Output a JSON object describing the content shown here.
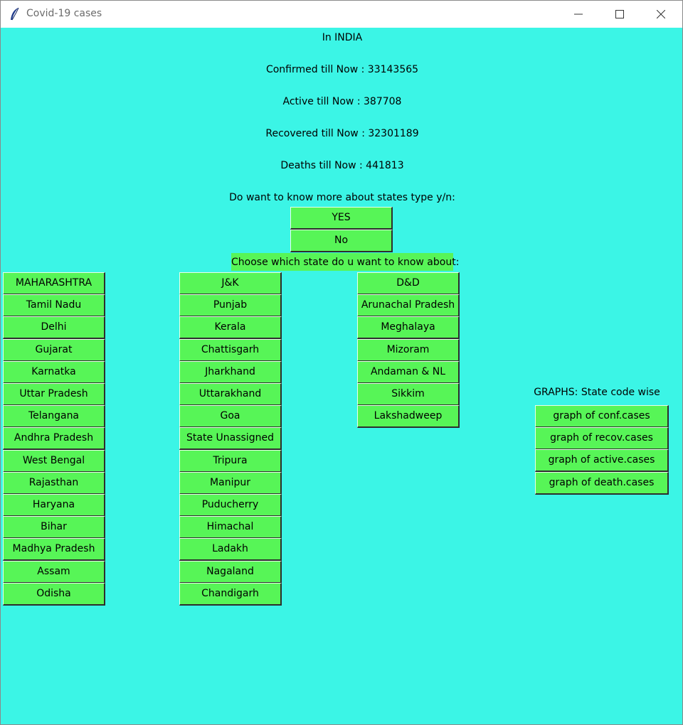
{
  "window": {
    "title": "Covid-19 cases"
  },
  "summary": {
    "country": "In INDIA",
    "confirmed": "Confirmed till Now : 33143565",
    "active": "Active till Now : 387708",
    "recovered": "Recovered till Now : 32301189",
    "deaths": "Deaths till Now : 441813"
  },
  "prompt": {
    "question": "Do want to know more about states type y/n:",
    "yes_label": "YES",
    "no_label": "No",
    "choose_label": "Choose which state do u want to know about:"
  },
  "states": {
    "column1": [
      "MAHARASHTRA",
      "Tamil Nadu",
      "Delhi",
      "Gujarat",
      "Karnatka",
      "Uttar Pradesh",
      "Telangana",
      "Andhra Pradesh",
      "West Bengal",
      "Rajasthan",
      "Haryana",
      "Bihar",
      "Madhya Pradesh",
      "Assam",
      "Odisha"
    ],
    "column2": [
      "J&K",
      "Punjab",
      "Kerala",
      "Chattisgarh",
      "Jharkhand",
      "Uttarakhand",
      "Goa",
      "State Unassigned",
      "Tripura",
      "Manipur",
      "Puducherry",
      "Himachal",
      "Ladakh",
      "Nagaland",
      "Chandigarh"
    ],
    "column3": [
      "D&D",
      "Arunachal Pradesh",
      "Meghalaya",
      "Mizoram",
      "Andaman & NL",
      "Sikkim",
      "Lakshadweep"
    ]
  },
  "graphs": {
    "heading": "GRAPHS: State code wise",
    "buttons": [
      "graph of conf.cases",
      "graph of recov.cases",
      "graph of active.cases",
      "graph of death.cases"
    ]
  },
  "colors": {
    "background": "#3bf5e6",
    "button": "#57f557"
  }
}
